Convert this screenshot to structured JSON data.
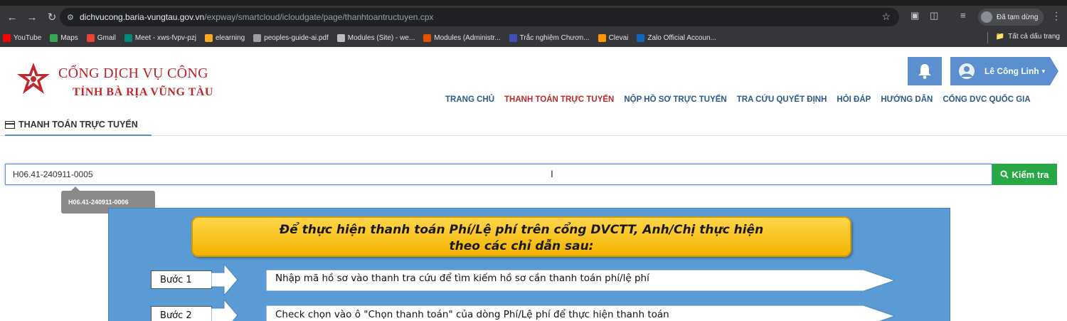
{
  "browser": {
    "url_host": "dichvucong.baria-vungtau.gov.vn",
    "url_path": "/expway/smartcloud/icloudgate/page/thanhtoantructuyen.cpx",
    "profile_status": "Đã tạm dừng",
    "bookmarks": [
      {
        "label": "YouTube",
        "color": "#ff0000"
      },
      {
        "label": "Maps",
        "color": "#34a853"
      },
      {
        "label": "Gmail",
        "color": "#ea4335"
      },
      {
        "label": "Meet - xws-fvpv-pzj",
        "color": "#00897b"
      },
      {
        "label": "elearning",
        "color": "#f9a825"
      },
      {
        "label": "peoples-guide-ai.pdf",
        "color": "#9e9e9e"
      },
      {
        "label": "Modules (Site) - we...",
        "color": "#bdbdbd"
      },
      {
        "label": "Modules (Administr...",
        "color": "#e65100"
      },
      {
        "label": "Trắc nghiệm Chươn...",
        "color": "#3f51b5"
      },
      {
        "label": "Clevai",
        "color": "#ff9800"
      },
      {
        "label": "Zalo Official Accoun...",
        "color": "#1565c0"
      }
    ],
    "all_bookmarks": "Tất cả dấu trang"
  },
  "header": {
    "title": "CỔNG DỊCH VỤ CÔNG",
    "subtitle": "TỈNH BÀ RỊA VŨNG TÀU",
    "user_name": "Lê Công Linh",
    "nav": [
      {
        "label": "TRANG CHỦ",
        "active": false
      },
      {
        "label": "THANH TOÁN TRỰC TUYẾN",
        "active": true
      },
      {
        "label": "NỘP HỒ SƠ TRỰC TUYẾN",
        "active": false
      },
      {
        "label": "TRA CỨU QUYẾT ĐỊNH",
        "active": false
      },
      {
        "label": "HỎI ĐÁP",
        "active": false
      },
      {
        "label": "HƯỚNG DẪN",
        "active": false
      },
      {
        "label": "CỔNG DVC QUỐC GIA",
        "active": false
      }
    ]
  },
  "section": {
    "title": "THANH TOÁN TRỰC TUYẾN"
  },
  "search": {
    "value": "H06.41-240911-0005",
    "button_label": "Kiểm tra",
    "suggestion": "H06.41-240911-0006"
  },
  "guide": {
    "banner_line1": "Để thực hiện thanh toán Phí/Lệ phí trên cổng DVCTT, Anh/Chị thực hiện",
    "banner_line2": "theo các chỉ dẫn sau:",
    "steps": [
      {
        "label": "Bước 1",
        "text": "Nhập mã hồ sơ vào thanh tra cứu để tìm kiếm hồ sơ cần thanh toán phí/lệ phí"
      },
      {
        "label": "Bước 2",
        "text": "Check chọn vào ô \"Chọn thanh toán\" của dòng Phí/Lệ phí để thực hiện thanh toán"
      }
    ]
  }
}
